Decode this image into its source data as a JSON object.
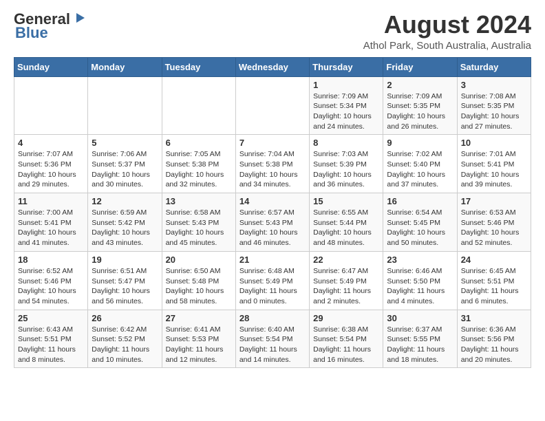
{
  "header": {
    "logo_line1": "General",
    "logo_line2": "Blue",
    "month_title": "August 2024",
    "location": "Athol Park, South Australia, Australia"
  },
  "weekdays": [
    "Sunday",
    "Monday",
    "Tuesday",
    "Wednesday",
    "Thursday",
    "Friday",
    "Saturday"
  ],
  "weeks": [
    [
      {
        "day": "",
        "content": ""
      },
      {
        "day": "",
        "content": ""
      },
      {
        "day": "",
        "content": ""
      },
      {
        "day": "",
        "content": ""
      },
      {
        "day": "1",
        "content": "Sunrise: 7:09 AM\nSunset: 5:34 PM\nDaylight: 10 hours\nand 24 minutes."
      },
      {
        "day": "2",
        "content": "Sunrise: 7:09 AM\nSunset: 5:35 PM\nDaylight: 10 hours\nand 26 minutes."
      },
      {
        "day": "3",
        "content": "Sunrise: 7:08 AM\nSunset: 5:35 PM\nDaylight: 10 hours\nand 27 minutes."
      }
    ],
    [
      {
        "day": "4",
        "content": "Sunrise: 7:07 AM\nSunset: 5:36 PM\nDaylight: 10 hours\nand 29 minutes."
      },
      {
        "day": "5",
        "content": "Sunrise: 7:06 AM\nSunset: 5:37 PM\nDaylight: 10 hours\nand 30 minutes."
      },
      {
        "day": "6",
        "content": "Sunrise: 7:05 AM\nSunset: 5:38 PM\nDaylight: 10 hours\nand 32 minutes."
      },
      {
        "day": "7",
        "content": "Sunrise: 7:04 AM\nSunset: 5:38 PM\nDaylight: 10 hours\nand 34 minutes."
      },
      {
        "day": "8",
        "content": "Sunrise: 7:03 AM\nSunset: 5:39 PM\nDaylight: 10 hours\nand 36 minutes."
      },
      {
        "day": "9",
        "content": "Sunrise: 7:02 AM\nSunset: 5:40 PM\nDaylight: 10 hours\nand 37 minutes."
      },
      {
        "day": "10",
        "content": "Sunrise: 7:01 AM\nSunset: 5:41 PM\nDaylight: 10 hours\nand 39 minutes."
      }
    ],
    [
      {
        "day": "11",
        "content": "Sunrise: 7:00 AM\nSunset: 5:41 PM\nDaylight: 10 hours\nand 41 minutes."
      },
      {
        "day": "12",
        "content": "Sunrise: 6:59 AM\nSunset: 5:42 PM\nDaylight: 10 hours\nand 43 minutes."
      },
      {
        "day": "13",
        "content": "Sunrise: 6:58 AM\nSunset: 5:43 PM\nDaylight: 10 hours\nand 45 minutes."
      },
      {
        "day": "14",
        "content": "Sunrise: 6:57 AM\nSunset: 5:43 PM\nDaylight: 10 hours\nand 46 minutes."
      },
      {
        "day": "15",
        "content": "Sunrise: 6:55 AM\nSunset: 5:44 PM\nDaylight: 10 hours\nand 48 minutes."
      },
      {
        "day": "16",
        "content": "Sunrise: 6:54 AM\nSunset: 5:45 PM\nDaylight: 10 hours\nand 50 minutes."
      },
      {
        "day": "17",
        "content": "Sunrise: 6:53 AM\nSunset: 5:46 PM\nDaylight: 10 hours\nand 52 minutes."
      }
    ],
    [
      {
        "day": "18",
        "content": "Sunrise: 6:52 AM\nSunset: 5:46 PM\nDaylight: 10 hours\nand 54 minutes."
      },
      {
        "day": "19",
        "content": "Sunrise: 6:51 AM\nSunset: 5:47 PM\nDaylight: 10 hours\nand 56 minutes."
      },
      {
        "day": "20",
        "content": "Sunrise: 6:50 AM\nSunset: 5:48 PM\nDaylight: 10 hours\nand 58 minutes."
      },
      {
        "day": "21",
        "content": "Sunrise: 6:48 AM\nSunset: 5:49 PM\nDaylight: 11 hours\nand 0 minutes."
      },
      {
        "day": "22",
        "content": "Sunrise: 6:47 AM\nSunset: 5:49 PM\nDaylight: 11 hours\nand 2 minutes."
      },
      {
        "day": "23",
        "content": "Sunrise: 6:46 AM\nSunset: 5:50 PM\nDaylight: 11 hours\nand 4 minutes."
      },
      {
        "day": "24",
        "content": "Sunrise: 6:45 AM\nSunset: 5:51 PM\nDaylight: 11 hours\nand 6 minutes."
      }
    ],
    [
      {
        "day": "25",
        "content": "Sunrise: 6:43 AM\nSunset: 5:51 PM\nDaylight: 11 hours\nand 8 minutes."
      },
      {
        "day": "26",
        "content": "Sunrise: 6:42 AM\nSunset: 5:52 PM\nDaylight: 11 hours\nand 10 minutes."
      },
      {
        "day": "27",
        "content": "Sunrise: 6:41 AM\nSunset: 5:53 PM\nDaylight: 11 hours\nand 12 minutes."
      },
      {
        "day": "28",
        "content": "Sunrise: 6:40 AM\nSunset: 5:54 PM\nDaylight: 11 hours\nand 14 minutes."
      },
      {
        "day": "29",
        "content": "Sunrise: 6:38 AM\nSunset: 5:54 PM\nDaylight: 11 hours\nand 16 minutes."
      },
      {
        "day": "30",
        "content": "Sunrise: 6:37 AM\nSunset: 5:55 PM\nDaylight: 11 hours\nand 18 minutes."
      },
      {
        "day": "31",
        "content": "Sunrise: 6:36 AM\nSunset: 5:56 PM\nDaylight: 11 hours\nand 20 minutes."
      }
    ]
  ]
}
